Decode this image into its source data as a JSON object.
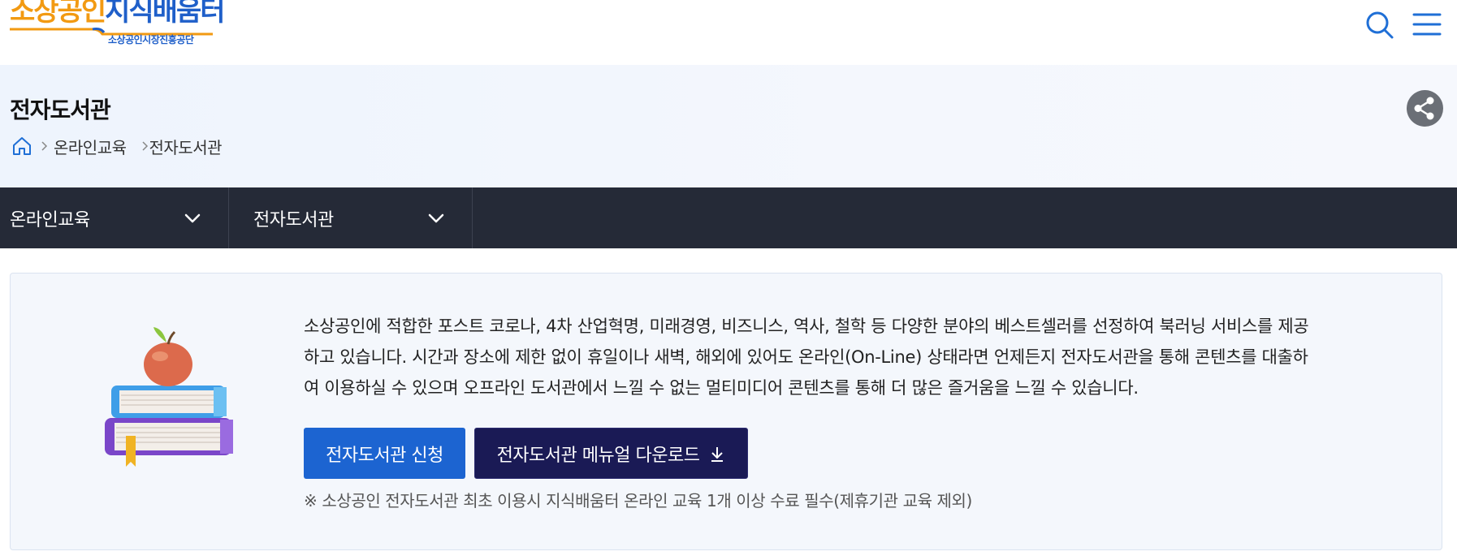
{
  "header": {
    "logo_part1": "소상공인",
    "logo_part2": "지식배움터",
    "logo_sub": "소상공인시장진흥공단",
    "search_icon": "search-icon",
    "menu_icon": "hamburger-menu-icon"
  },
  "title_band": {
    "title": "전자도서관",
    "share_icon": "share-icon",
    "breadcrumb": {
      "home_icon": "home-icon",
      "items": [
        "온라인교육",
        "전자도서관"
      ]
    }
  },
  "navbar": {
    "dropdowns": [
      {
        "label": "온라인교육",
        "icon": "chevron-down-icon"
      },
      {
        "label": "전자도서관",
        "icon": "chevron-down-icon"
      }
    ]
  },
  "content": {
    "illustration": "books-with-apple-illustration",
    "description_lines": [
      "소상공인에 적합한 포스트 코로나, 4차 산업혁명, 미래경영, 비즈니스, 역사, 철학 등 다양한 분야의 베스트셀러를 선정하여 북러닝 서비스를 제공",
      "하고 있습니다. 시간과 장소에 제한 없이 휴일이나 새벽, 해외에 있어도 온라인(On-Line) 상태라면 언제든지 전자도서관을 통해 콘텐츠를 대출하",
      "여 이용하실 수 있으며 오프라인 도서관에서 느낄 수 없는 멀티미디어 콘텐츠를 통해 더 많은 즐거움을 느낄 수 있습니다."
    ],
    "apply_button": "전자도서관 신청",
    "manual_button": "전자도서관 메뉴얼 다운로드",
    "download_icon": "download-icon",
    "note": "※ 소상공인 전자도서관 최초 이용시 지식배움터 온라인 교육 1개 이상 수료 필수(제휴기관 교육 제외)"
  },
  "colors": {
    "brand_orange": "#f29a12",
    "brand_blue": "#1f5fc9",
    "nav_bg": "#252a37",
    "apply_btn": "#1c64d1",
    "manual_btn": "#1a1a55"
  }
}
